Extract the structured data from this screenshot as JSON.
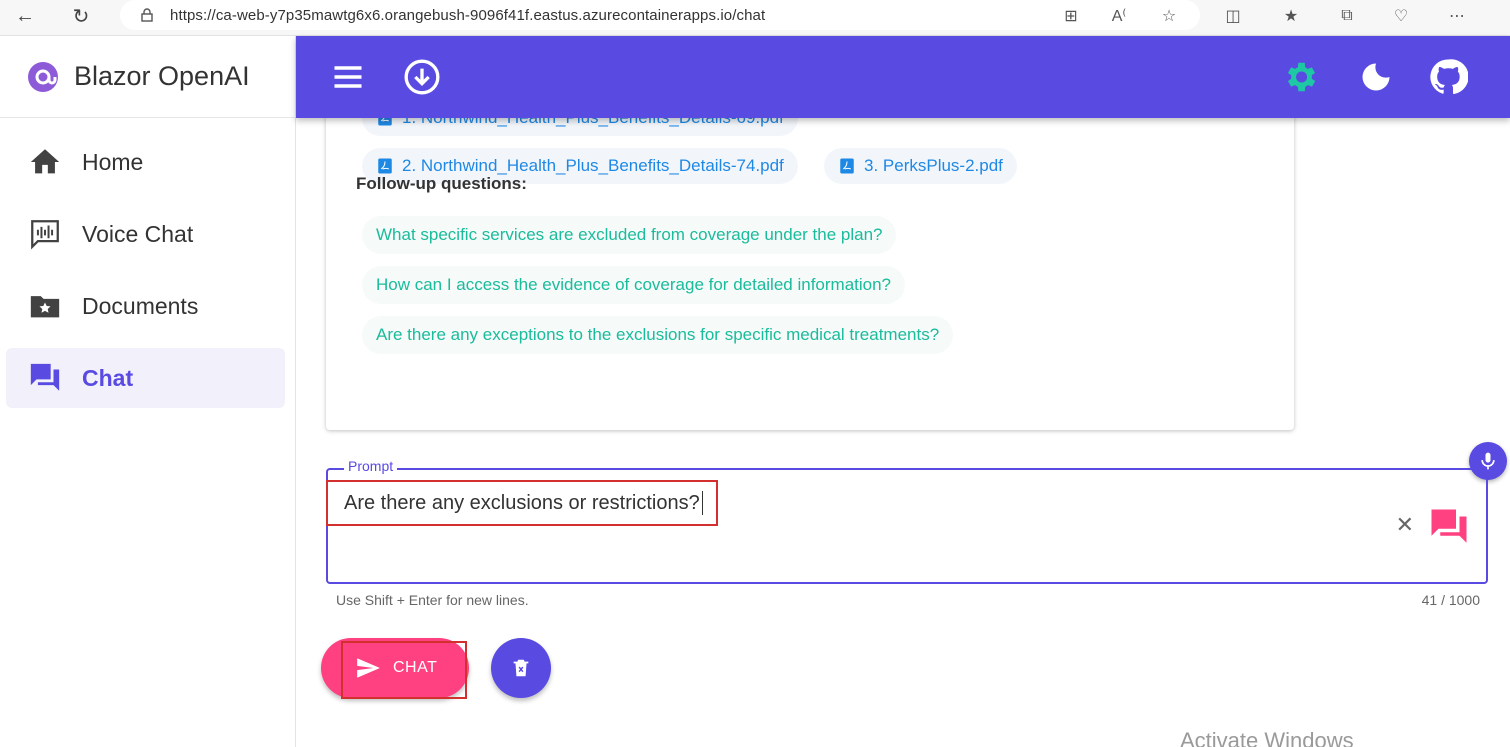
{
  "browser": {
    "url": "https://ca-web-y7p35mawtg6x6.orangebush-9096f41f.eastus.azurecontainerapps.io/chat"
  },
  "sidebar": {
    "brand": "Blazor OpenAI",
    "items": [
      {
        "label": "Home",
        "icon": "home-icon"
      },
      {
        "label": "Voice Chat",
        "icon": "voice-chat-icon"
      },
      {
        "label": "Documents",
        "icon": "documents-folder-icon"
      },
      {
        "label": "Chat",
        "icon": "chat-icon",
        "active": true
      }
    ]
  },
  "answer": {
    "citations": [
      "1. Northwind_Health_Plus_Benefits_Details-69.pdf",
      "2. Northwind_Health_Plus_Benefits_Details-74.pdf",
      "3. PerksPlus-2.pdf"
    ],
    "followup_title": "Follow-up questions:",
    "followups": [
      "What specific services are excluded from coverage under the plan?",
      "How can I access the evidence of coverage for detailed information?",
      "Are there any exceptions to the exclusions for specific medical treatments?"
    ]
  },
  "prompt": {
    "label": "Prompt",
    "value": "Are there any exclusions or restrictions?",
    "helper": "Use Shift + Enter for new lines.",
    "counter": "41 / 1000"
  },
  "actions": {
    "chat_label": "CHAT"
  },
  "watermark": "Activate Windows",
  "colors": {
    "primary": "#594ae2",
    "secondary": "#ff4081",
    "followup": "#1abc9c",
    "citation": "#1e88e5",
    "settings_icon": "#1ec8a5"
  }
}
